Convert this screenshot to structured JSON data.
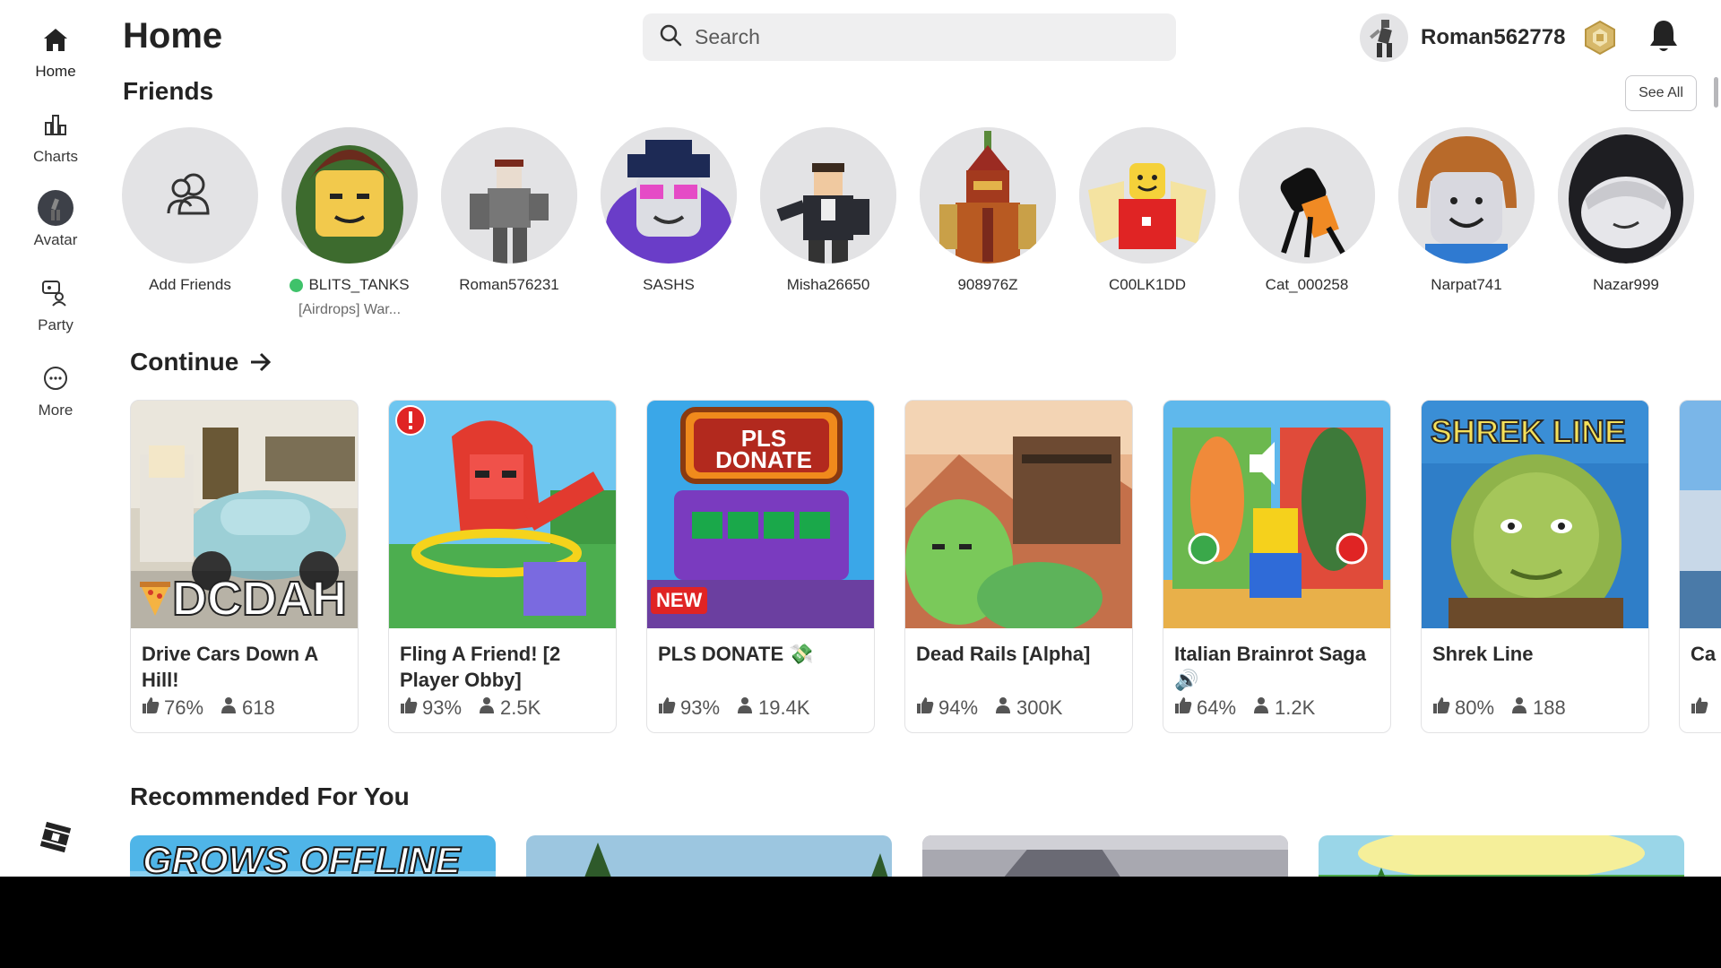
{
  "sidebar": {
    "items": [
      {
        "label": "Home",
        "icon": "home-icon"
      },
      {
        "label": "Charts",
        "icon": "charts-icon"
      },
      {
        "label": "Avatar",
        "icon": "avatar-icon"
      },
      {
        "label": "Party",
        "icon": "party-icon"
      },
      {
        "label": "More",
        "icon": "more-icon"
      }
    ],
    "logo_icon": "roblox-logo-icon"
  },
  "header": {
    "title": "Home",
    "search_placeholder": "Search",
    "username": "Roman562778",
    "robux_icon": "robux-icon",
    "notifications_icon": "bell-icon"
  },
  "friends": {
    "title": "Friends",
    "see_all": "See All",
    "add_label": "Add Friends",
    "list": [
      {
        "name": "BLITS_TANKS",
        "online": true,
        "status": "[Airdrops] War..."
      },
      {
        "name": "Roman576231",
        "online": false,
        "status": ""
      },
      {
        "name": "SASHS",
        "online": false,
        "status": ""
      },
      {
        "name": "Misha26650",
        "online": false,
        "status": ""
      },
      {
        "name": "908976Z",
        "online": false,
        "status": ""
      },
      {
        "name": "C00LK1DD",
        "online": false,
        "status": ""
      },
      {
        "name": "Cat_000258",
        "online": false,
        "status": ""
      },
      {
        "name": "Narpat741",
        "online": false,
        "status": ""
      },
      {
        "name": "Nazar999",
        "online": false,
        "status": ""
      }
    ]
  },
  "continue": {
    "title": "Continue",
    "games": [
      {
        "name": "Drive Cars Down A Hill!",
        "rating": "76%",
        "players": "618",
        "thumb_text": "DCDAH"
      },
      {
        "name": "Fling A Friend! [2 Player Obby]",
        "rating": "93%",
        "players": "2.5K",
        "thumb_text": ""
      },
      {
        "name": "PLS DONATE 💸",
        "rating": "93%",
        "players": "19.4K",
        "thumb_text": "PLS DONATE",
        "badge": "NEW"
      },
      {
        "name": "Dead Rails [Alpha]",
        "rating": "94%",
        "players": "300K",
        "thumb_text": ""
      },
      {
        "name": "Italian Brainrot Saga 🔊",
        "rating": "64%",
        "players": "1.2K",
        "thumb_text": ""
      },
      {
        "name": "Shrek Line",
        "rating": "80%",
        "players": "188",
        "thumb_text": "SHREK LINE"
      },
      {
        "name": "Ca Yo",
        "rating": "",
        "players": "",
        "thumb_text": ""
      }
    ]
  },
  "recommended": {
    "title": "Recommended For You",
    "items": [
      {
        "thumb_text": "GROWS OFFLINE"
      },
      {
        "thumb_text": ""
      },
      {
        "thumb_text": ""
      },
      {
        "thumb_text": ""
      }
    ]
  }
}
